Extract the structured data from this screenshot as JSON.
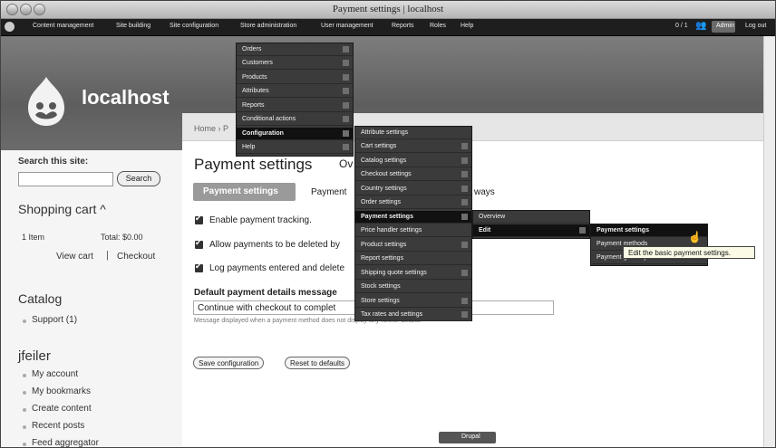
{
  "window": {
    "title": "Payment settings | localhost"
  },
  "admin_menu": {
    "items": [
      "Content management",
      "Site building",
      "Site configuration",
      "Store administration",
      "User management",
      "Reports",
      "Roles",
      "Help"
    ],
    "user_count": "0 / 1",
    "user_button": "Admin",
    "logout": "Log out"
  },
  "site": {
    "name": "localhost"
  },
  "breadcrumb": "Home › P",
  "page": {
    "title": "Payment settings",
    "title_tail": "Ov",
    "tab_active": "Payment settings",
    "tab_partial": "Payment",
    "tab_tail": "ways",
    "checkboxes": [
      "Enable payment tracking.",
      "Allow payments to be deleted by",
      "Log payments entered and delete"
    ],
    "message_label": "Default payment details message",
    "message_value": "Continue with checkout to complet",
    "message_help": "Message displayed when a payment method does not display any further details.",
    "save_button": "Save configuration",
    "reset_button": "Reset to defaults"
  },
  "sidebar": {
    "search_label": "Search this site:",
    "search_button": "Search",
    "cart_title": "Shopping cart ^",
    "cart_items": "1 Item",
    "cart_total": "Total: $0.00",
    "view_cart": "View cart",
    "separator": "|",
    "checkout": "Checkout",
    "catalog_title": "Catalog",
    "catalog_items": [
      "Support (1)"
    ],
    "user_title": "jfeiler",
    "user_items": [
      "My account",
      "My bookmarks",
      "Create content",
      "Recent posts",
      "Feed aggregator"
    ]
  },
  "menu_store": [
    "Orders",
    "Customers",
    "Products",
    "Attributes",
    "Reports",
    "Conditional actions",
    "Configuration",
    "Help"
  ],
  "menu_store_selected": "Configuration",
  "menu_config": [
    "Attribute settings",
    "Cart settings",
    "Catalog settings",
    "Checkout settings",
    "Country settings",
    "Order settings",
    "Payment settings",
    "Price handler settings",
    "Product settings",
    "Report settings",
    "Shipping quote settings",
    "Stock settings",
    "Store settings",
    "Tax rates and settings"
  ],
  "menu_config_selected": "Payment settings",
  "menu_payment": [
    "Overview",
    "Edit"
  ],
  "menu_payment_selected": "Edit",
  "menu_edit": [
    "Payment settings",
    "Payment methods",
    "Payment gateways"
  ],
  "menu_edit_selected": "Payment settings",
  "tooltip": "Edit the basic payment settings.",
  "footer_badge": "Drupal"
}
